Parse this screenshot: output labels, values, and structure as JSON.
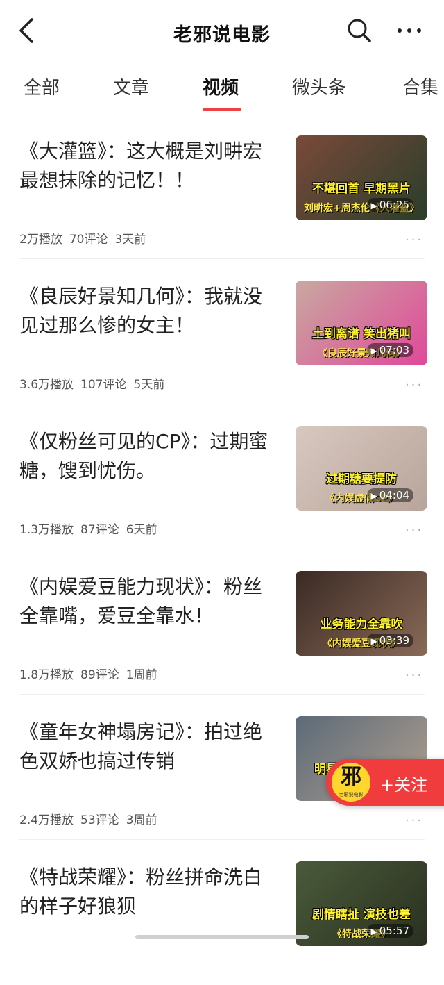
{
  "header": {
    "title": "老邪说电影",
    "back_icon": "chevron-left-icon",
    "search_icon": "search-icon",
    "more_icon": "more-horizontal-icon"
  },
  "tabs": [
    {
      "label": "全部"
    },
    {
      "label": "文章"
    },
    {
      "label": "视频",
      "active": true
    },
    {
      "label": "微头条"
    },
    {
      "label": "合集"
    }
  ],
  "colors": {
    "accent": "#f04142",
    "follow_bg": "#f03c3c"
  },
  "feed": [
    {
      "title": "《大灌篮》：这大概是刘畊宏最想抹除的记忆！！",
      "thumb_caption_1": "不堪回首 早期黑片",
      "thumb_caption_2": "刘畊宏+周杰伦《大灌篮》",
      "duration": "06:25",
      "plays": "2万播放",
      "comments": "70评论",
      "time": "3天前",
      "thumb_colors": [
        "#7a4a3a",
        "#2a3d2a"
      ]
    },
    {
      "title": "《良辰好景知几何》：我就没见过那么惨的女主！",
      "thumb_caption_1": "土到离谱 笑出猪叫",
      "thumb_caption_2": "《良辰好景知几何》",
      "duration": "07:03",
      "plays": "3.6万播放",
      "comments": "107评论",
      "time": "5天前",
      "thumb_colors": [
        "#c9a9a0",
        "#e0489a"
      ]
    },
    {
      "title": "《仅粉丝可见的CP》：过期蜜糖，馊到忧伤。",
      "thumb_caption_1": "过期糖要提防",
      "thumb_caption_2": "《内娱虚假CP》",
      "duration": "04:04",
      "plays": "1.3万播放",
      "comments": "87评论",
      "time": "6天前",
      "thumb_colors": [
        "#d8c8c0",
        "#b8a49a"
      ]
    },
    {
      "title": "《内娱爱豆能力现状》：粉丝全靠嘴，爱豆全靠水！",
      "thumb_caption_1": "业务能力全靠吹",
      "thumb_caption_2": "《内娱爱豆现状》",
      "duration": "03:39",
      "plays": "1.8万播放",
      "comments": "89评论",
      "time": "1周前",
      "thumb_colors": [
        "#3a2a24",
        "#8a6a58"
      ]
    },
    {
      "title": "《童年女神塌房记》：拍过绝色双娇也搞过传销",
      "thumb_caption_1": "明星塌房成为日常",
      "thumb_caption_2": "《消失",
      "duration": "",
      "plays": "2.4万播放",
      "comments": "53评论",
      "time": "3周前",
      "thumb_colors": [
        "#5c6a78",
        "#b0a090"
      ]
    },
    {
      "title": "《特战荣耀》：粉丝拼命洗白的样子好狼狈",
      "thumb_caption_1": "剧情瞎扯 演技也差",
      "thumb_caption_2": "《特战荣耀》",
      "duration": "05:57",
      "plays": "",
      "comments": "",
      "time": "",
      "thumb_colors": [
        "#4a5a3a",
        "#2a3020"
      ]
    }
  ],
  "follow": {
    "label": "+关注",
    "avatar_char": "邪",
    "avatar_sub": "老邪说电影"
  }
}
